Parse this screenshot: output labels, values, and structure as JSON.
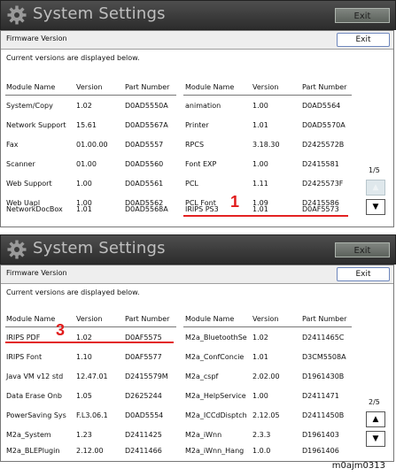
{
  "screens": [
    {
      "title": "System Settings",
      "exit_top": "Exit",
      "panel_title": "Firmware Version",
      "exit_button": "Exit",
      "description": "Current versions are displayed below.",
      "headers": [
        "Module Name",
        "Version",
        "Part Number",
        "Module Name",
        "Version",
        "Part Number"
      ],
      "left_rows": [
        [
          "System/Copy",
          "1.02",
          "D0AD5550A"
        ],
        [
          "Network Support",
          "15.61",
          "D0AD5567A"
        ],
        [
          "Fax",
          "01.00.00",
          "D0AD5557"
        ],
        [
          "Scanner",
          "01.00",
          "D0AD5560"
        ],
        [
          "Web Support",
          "1.00",
          "D0AD5561"
        ],
        [
          "Web Uapl",
          "1.00",
          "D0AD5562"
        ],
        [
          "NetworkDocBox",
          "1.01",
          "D0AD5568A"
        ]
      ],
      "right_rows": [
        [
          "animation",
          "1.00",
          "D0AD5564"
        ],
        [
          "Printer",
          "1.01",
          "D0AD5570A"
        ],
        [
          "RPCS",
          "3.18.30",
          "D2425572B"
        ],
        [
          "Font EXP",
          "1.00",
          "D2415581"
        ],
        [
          "PCL",
          "1.11",
          "D2425573F"
        ],
        [
          "PCL Font",
          "1.09",
          "D2415586"
        ],
        [
          "IRIPS PS3",
          "1.01",
          "D0AF5573"
        ]
      ],
      "page": "1/5",
      "up_arrow": "▲",
      "down_arrow": "▼",
      "callout": "1"
    },
    {
      "title": "System Settings",
      "exit_top": "Exit",
      "panel_title": "Firmware Version",
      "exit_button": "Exit",
      "description": "Current versions are displayed below.",
      "headers": [
        "Module Name",
        "Version",
        "Part Number",
        "Module Name",
        "Version",
        "Part Number"
      ],
      "left_rows": [
        [
          "IRIPS PDF",
          "1.02",
          "D0AF5575"
        ],
        [
          "IRIPS Font",
          "1.10",
          "D0AF5577"
        ],
        [
          "Java VM v12 std",
          "12.47.01",
          "D2415579M"
        ],
        [
          "Data Erase Onb",
          "1.05",
          "D2625244"
        ],
        [
          "PowerSaving Sys",
          "F.L3.06.1",
          "D0AD5554"
        ],
        [
          "M2a_System",
          "1.23",
          "D2411425"
        ],
        [
          "M2a_BLEPlugin",
          "2.12.00",
          "D2411466"
        ]
      ],
      "right_rows": [
        [
          "M2a_BluetoothSe",
          "1.02",
          "D2411465C"
        ],
        [
          "M2a_ConfConcie",
          "1.01",
          "D3CM5508A"
        ],
        [
          "M2a_cspf",
          "2.02.00",
          "D1961430B"
        ],
        [
          "M2a_HelpService",
          "1.00",
          "D2411471"
        ],
        [
          "M2a_ICCdDisptch",
          "2.12.05",
          "D2411450B"
        ],
        [
          "M2a_iWnn",
          "2.3.3",
          "D1961403"
        ],
        [
          "M2a_iWnn_Hang",
          "1.0.0",
          "D1961406"
        ]
      ],
      "page": "2/5",
      "up_arrow": "▲",
      "down_arrow": "▼",
      "callout": "3"
    }
  ],
  "caption": "m0ajm0313"
}
